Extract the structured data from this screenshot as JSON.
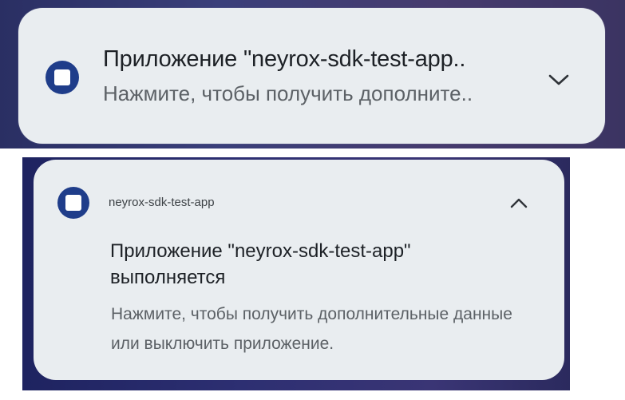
{
  "collapsed_notification": {
    "icon": "app-square-icon",
    "title": "Приложение \"neyrox-sdk-test-app..",
    "text": "Нажмите, чтобы получить дополните..",
    "expand_icon": "chevron-down-icon"
  },
  "expanded_notification": {
    "icon": "app-square-icon",
    "app_name": "neyrox-sdk-test-app",
    "collapse_icon": "chevron-up-icon",
    "title": "Приложение \"neyrox-sdk-test-app\" выполняется",
    "text": "Нажмите, чтобы получить дополнительные данные или выключить приложение."
  },
  "colors": {
    "card_background": "#e9edf0",
    "icon_blue": "#1f3d8a",
    "title_text": "#1d2126",
    "secondary_text": "#5c6166"
  }
}
